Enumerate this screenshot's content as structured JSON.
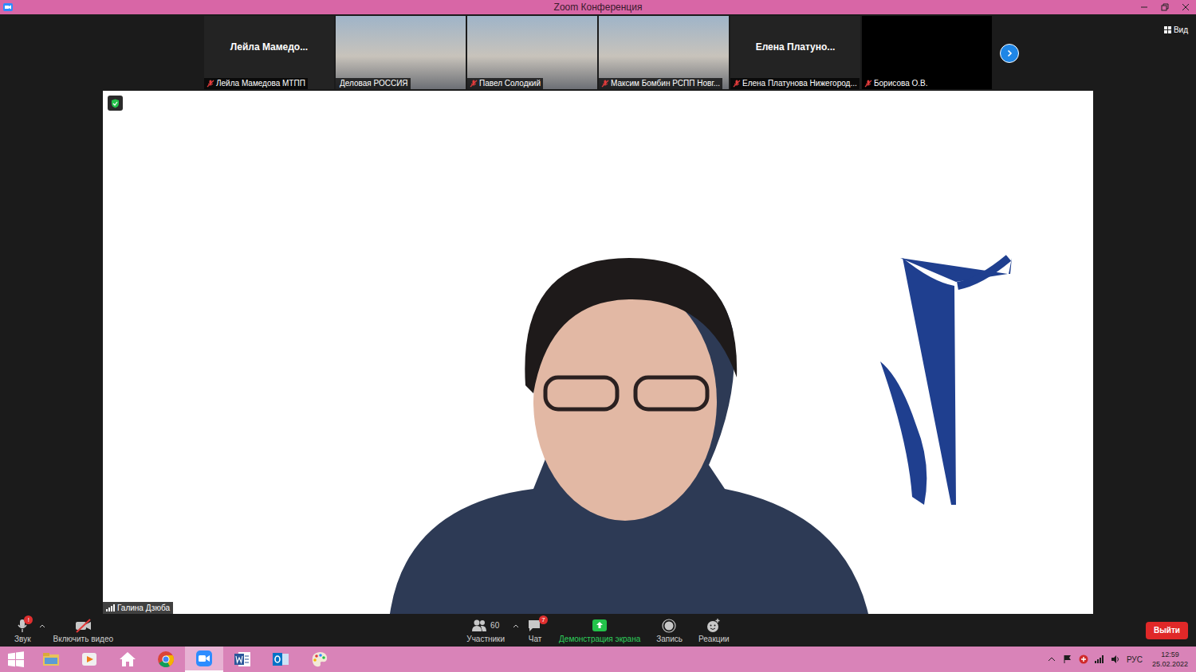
{
  "window": {
    "title": "Zoom Конференция"
  },
  "view_button": {
    "label": "Вид"
  },
  "gallery": {
    "tiles": [
      {
        "kind": "name",
        "name": "Лейла  Мамедо...",
        "label": "Лейла Мамедова МТПП",
        "muted": true
      },
      {
        "kind": "video",
        "label": "Деловая РОССИЯ",
        "muted": false
      },
      {
        "kind": "video",
        "label": "Павел Солодкий",
        "muted": true
      },
      {
        "kind": "video",
        "label": "Максим Бомбин РСПП Новг...",
        "muted": true
      },
      {
        "kind": "name",
        "name": "Елена  Платуно...",
        "label": "Елена Платунова Нижегород...",
        "muted": true
      },
      {
        "kind": "blank",
        "label": "Борисова О.В.",
        "muted": true
      }
    ]
  },
  "main_video": {
    "speaker": "Галина  Дзюба"
  },
  "toolbar": {
    "audio": {
      "label": "Звук",
      "alert": "!"
    },
    "video": {
      "label": "Включить видео",
      "on": false
    },
    "items": [
      {
        "kind": "participants",
        "label": "Участники",
        "count": "60"
      },
      {
        "kind": "chat",
        "label": "Чат",
        "badge": "7"
      },
      {
        "kind": "share",
        "label": "Демонстрация экрана"
      },
      {
        "kind": "record",
        "label": "Запись"
      },
      {
        "kind": "reactions",
        "label": "Реакции"
      }
    ],
    "leave": "Выйти"
  },
  "taskbar": {
    "apps": [
      {
        "kind": "start",
        "selected": false
      },
      {
        "kind": "explorer",
        "selected": false
      },
      {
        "kind": "media",
        "selected": false
      },
      {
        "kind": "home",
        "selected": false
      },
      {
        "kind": "chrome",
        "selected": false
      },
      {
        "kind": "zoom",
        "selected": true
      },
      {
        "kind": "word",
        "selected": false
      },
      {
        "kind": "outlook",
        "selected": false
      },
      {
        "kind": "paint",
        "selected": false
      }
    ],
    "tray": {
      "language": "РУС",
      "time": "12:59",
      "date": "25.02.2022"
    }
  }
}
